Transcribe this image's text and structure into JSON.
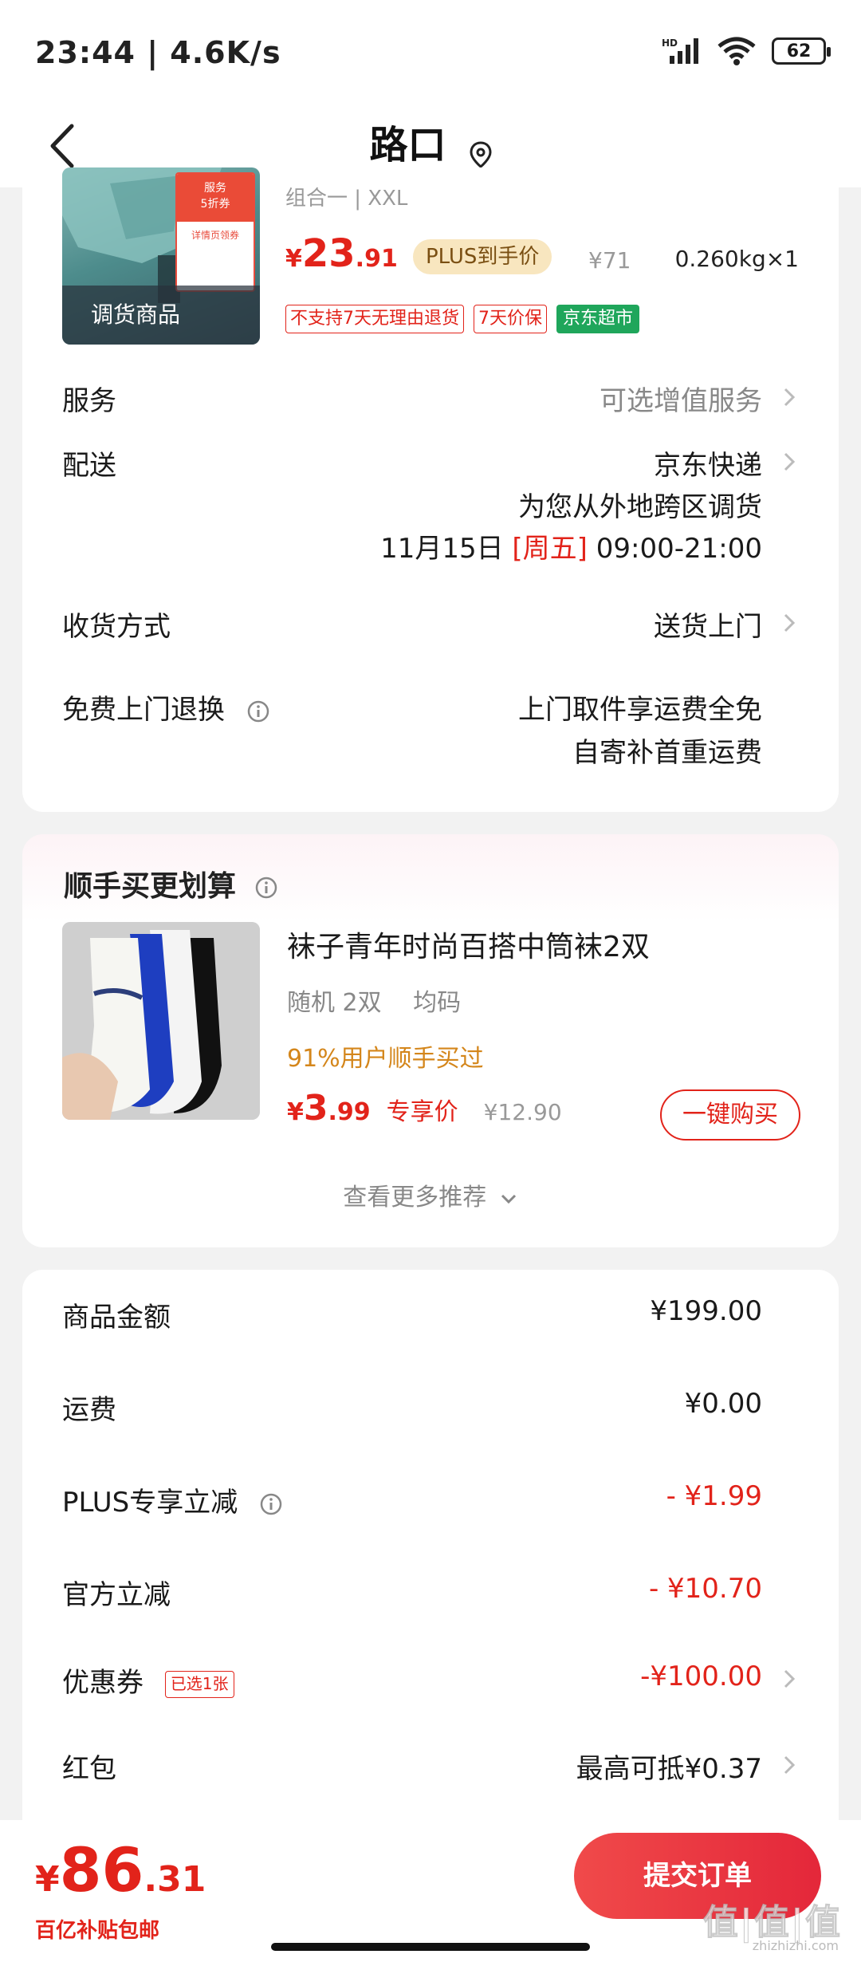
{
  "status_bar": {
    "time": "23:44 | 4.6K/s",
    "battery": "62"
  },
  "nav": {
    "title": "路口"
  },
  "product": {
    "image_label": "调货商品",
    "promo_head": "服务\n5折券",
    "promo_sub": "详情页领券",
    "variant": "组合一 | XXL",
    "price_symbol": "¥",
    "price_int": "23",
    "price_dec": ".91",
    "plus_tag": "PLUS到手价",
    "orig_price": "¥71",
    "weight": "0.260kg×1",
    "tags": [
      "不支持7天无理由退货",
      "7天价保"
    ],
    "green_tag": "京东超市"
  },
  "rows": {
    "service": {
      "label": "服务",
      "value": "可选增值服务"
    },
    "delivery": {
      "label": "配送",
      "value": "京东快递",
      "line2": "为您从外地跨区调货",
      "date": "11月15日",
      "weekday": "[周五]",
      "time": "09:00-21:00"
    },
    "receive": {
      "label": "收货方式",
      "value": "送货上门"
    },
    "free_return": {
      "label": "免费上门退换",
      "line1": "上门取件享运费全免",
      "line2": "自寄补首重运费"
    }
  },
  "recommend": {
    "title": "顺手买更划算",
    "item_title": "袜子青年时尚百搭中筒袜2双",
    "spec1": "随机 2双",
    "spec2": "均码",
    "bought": "91%用户顺手买过",
    "price_symbol": "¥",
    "price_int": "3",
    "price_dec": ".99",
    "excl": "专享价",
    "orig": "¥12.90",
    "buy_label": "一键购买",
    "more": "查看更多推荐"
  },
  "summary": {
    "goods": {
      "label": "商品金额",
      "value": "¥199.00"
    },
    "shipping": {
      "label": "运费",
      "value": "¥0.00"
    },
    "plus": {
      "label": "PLUS专享立减",
      "value": "- ¥1.99"
    },
    "official": {
      "label": "官方立减",
      "value": "- ¥10.70"
    },
    "coupon": {
      "label": "优惠券",
      "tag": "已选1张",
      "value": "-¥100.00"
    },
    "redpack": {
      "label": "红包",
      "value": "最高可抵¥0.37"
    }
  },
  "bottom": {
    "total_symbol": "¥",
    "total_int": "86",
    "total_dec": ".31",
    "subsidy": "百亿补贴包邮",
    "submit": "提交订单"
  },
  "watermark": {
    "main": "值|值|值",
    "sub": "zhizhizhi.com"
  },
  "colors": {
    "accent_red": "#e2231a",
    "plus_gold": "#f8e6bf",
    "green": "#1fa65b",
    "orange": "#d4861b"
  }
}
